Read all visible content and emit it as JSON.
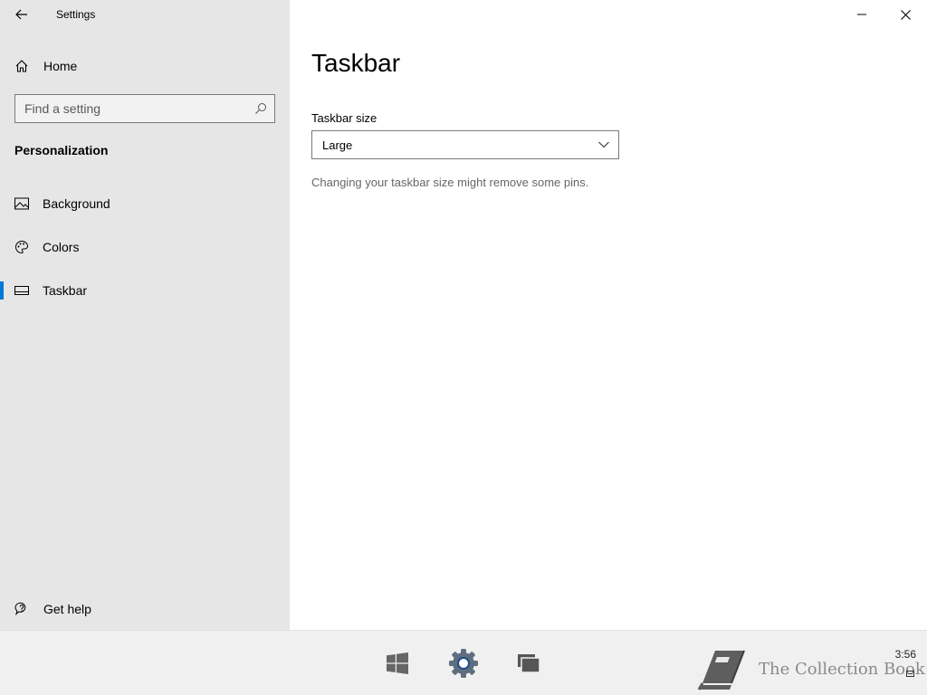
{
  "window": {
    "title": "Settings"
  },
  "sidebar": {
    "home_label": "Home",
    "search_placeholder": "Find a setting",
    "section_title": "Personalization",
    "items": [
      {
        "label": "Background",
        "icon": "picture-icon"
      },
      {
        "label": "Colors",
        "icon": "palette-icon"
      },
      {
        "label": "Taskbar",
        "icon": "taskbar-icon",
        "active": true
      }
    ],
    "help_label": "Get help"
  },
  "main": {
    "title": "Taskbar",
    "taskbar_size": {
      "label": "Taskbar size",
      "value": "Large"
    },
    "hint": "Changing your taskbar size might remove some pins."
  },
  "taskbar": {
    "icons": [
      "windows-start-icon",
      "settings-gear-icon",
      "task-view-icon"
    ],
    "watermark_text": "The Collection Book",
    "clock": "3:56"
  },
  "colors": {
    "accent": "#0078d7",
    "sidebar_bg": "#e6e6e6",
    "taskbar_bg": "#f0f0f0"
  }
}
